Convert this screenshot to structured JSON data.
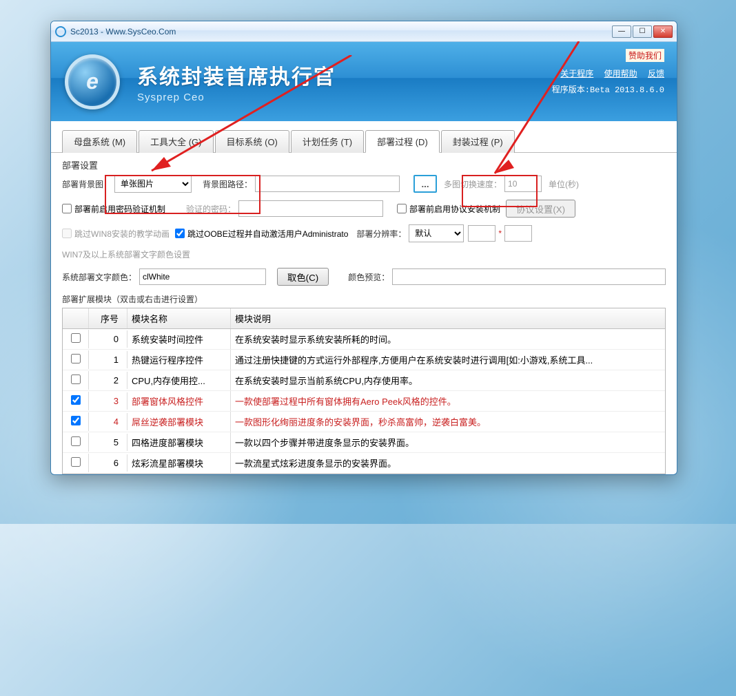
{
  "window": {
    "title": "Sc2013 - Www.SysCeo.Com"
  },
  "header": {
    "title": "系统封装首席执行官",
    "subtitle": "Sysprep  Ceo",
    "sponsor": "赞助我们",
    "links": {
      "about": "关于程序",
      "help": "使用帮助",
      "feedback": "反馈"
    },
    "version": "程序版本:Beta 2013.8.6.0"
  },
  "tabs": {
    "mother": "母盘系统 (M)",
    "tools": "工具大全 (G)",
    "target": "目标系统 (O)",
    "tasks": "计划任务 (T)",
    "deploy": "部署过程 (D)",
    "pack": "封装过程 (P)"
  },
  "deploy": {
    "group_title": "部署设置",
    "bg_label": "部署背景图：",
    "bg_mode": "单张图片",
    "bg_path_label": "背景图路径：",
    "browse": "...",
    "switch_speed_label": "多图切换速度：",
    "switch_speed_value": "10",
    "switch_unit": "单位(秒)",
    "pwd_enable": "部署前启用密码验证机制",
    "pwd_label": "验证的密码：",
    "proto_enable": "部署前启用协议安装机制",
    "proto_btn": "协议设置(X)",
    "skip_win8": "跳过WIN8安装的教学动画",
    "skip_oobe": "跳过OOBE过程并自动激活用户Administrato",
    "res_label": "部署分辨率：",
    "res_value": "默认",
    "res_sep": "*",
    "font_section": "WIN7及以上系统部署文字颜色设置",
    "font_color_label": "系统部署文字颜色：",
    "font_color_value": "clWhite",
    "pick_color": "取色(C)",
    "preview_label": "颜色预览："
  },
  "modules": {
    "title": "部署扩展模块（双击或右击进行设置）",
    "headers": {
      "num": "序号",
      "name": "模块名称",
      "desc": "模块说明"
    },
    "rows": [
      {
        "checked": false,
        "num": "0",
        "name": "系统安装时间控件",
        "desc": "在系统安装时显示系统安装所耗的时间。",
        "red": false
      },
      {
        "checked": false,
        "num": "1",
        "name": "热键运行程序控件",
        "desc": "通过注册快捷键的方式运行外部程序,方便用户在系统安装时进行调用[如:小游戏,系统工具...",
        "red": false
      },
      {
        "checked": false,
        "num": "2",
        "name": "CPU,内存使用控...",
        "desc": "在系统安装时显示当前系统CPU,内存使用率。",
        "red": false
      },
      {
        "checked": true,
        "num": "3",
        "name": "部署窗体风格控件",
        "desc": "一款使部署过程中所有窗体拥有Aero Peek风格的控件。",
        "red": true
      },
      {
        "checked": true,
        "num": "4",
        "name": "屌丝逆袭部署模块",
        "desc": "一款图形化绚丽进度条的安装界面，秒杀高富帅，逆袭白富美。",
        "red": true
      },
      {
        "checked": false,
        "num": "5",
        "name": "四格进度部署模块",
        "desc": "一款以四个步骤并带进度条显示的安装界面。",
        "red": false
      },
      {
        "checked": false,
        "num": "6",
        "name": "炫彩流星部署模块",
        "desc": "一款流星式炫彩进度条显示的安装界面。",
        "red": false
      }
    ]
  }
}
